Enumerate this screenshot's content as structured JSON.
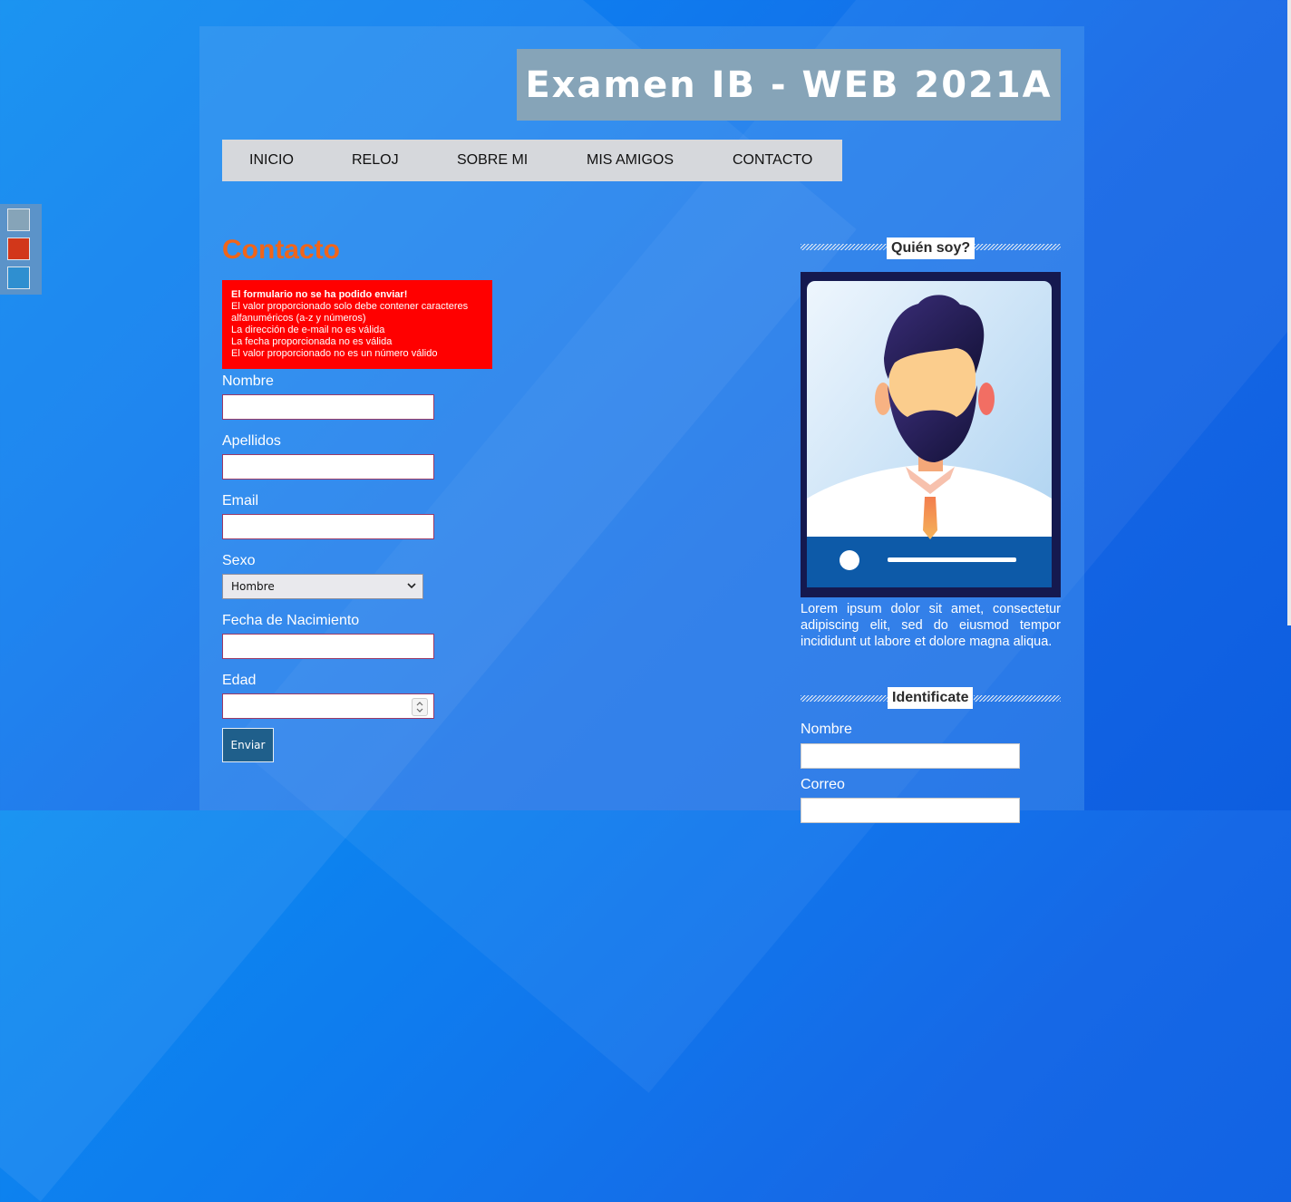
{
  "site": {
    "title": "Examen IB - WEB 2021A"
  },
  "nav": [
    "INICIO",
    "RELOJ",
    "SOBRE MI",
    "MIS AMIGOS",
    "CONTACTO"
  ],
  "palette": [
    "#86a4b8",
    "#d2371a",
    "#2f8fd0"
  ],
  "contact": {
    "heading": "Contacto",
    "errors": {
      "title": "El formulario no se ha podido enviar!",
      "lines": [
        "El valor proporcionado solo debe contener caracteres alfanuméricos (a-z y números)",
        "La dirección de e-mail no es válida",
        "La fecha proporcionada no es válida",
        "El valor proporcionado no es un número válido"
      ]
    },
    "fields": {
      "nombre": {
        "label": "Nombre",
        "value": ""
      },
      "apellidos": {
        "label": "Apellidos",
        "value": ""
      },
      "email": {
        "label": "Email",
        "value": ""
      },
      "sexo": {
        "label": "Sexo",
        "selected": "Hombre"
      },
      "fecha": {
        "label": "Fecha de Nacimiento",
        "value": ""
      },
      "edad": {
        "label": "Edad",
        "value": ""
      }
    },
    "submit_label": "Enviar"
  },
  "sidebar": {
    "about": {
      "title": "Quién soy?",
      "text": "Lorem ipsum dolor sit amet, consectetur adipiscing elit, sed do eiusmod tempor incididunt ut labore et dolore magna aliqua."
    },
    "identify": {
      "title": "Identificate",
      "nombre_label": "Nombre",
      "correo_label": "Correo"
    }
  },
  "colors": {
    "accent_orange": "#f0651a",
    "error_red": "#ff0000",
    "title_bg": "#86a4b8",
    "nav_bg": "#d6d8dc",
    "button_bg": "#1f5f8b"
  }
}
